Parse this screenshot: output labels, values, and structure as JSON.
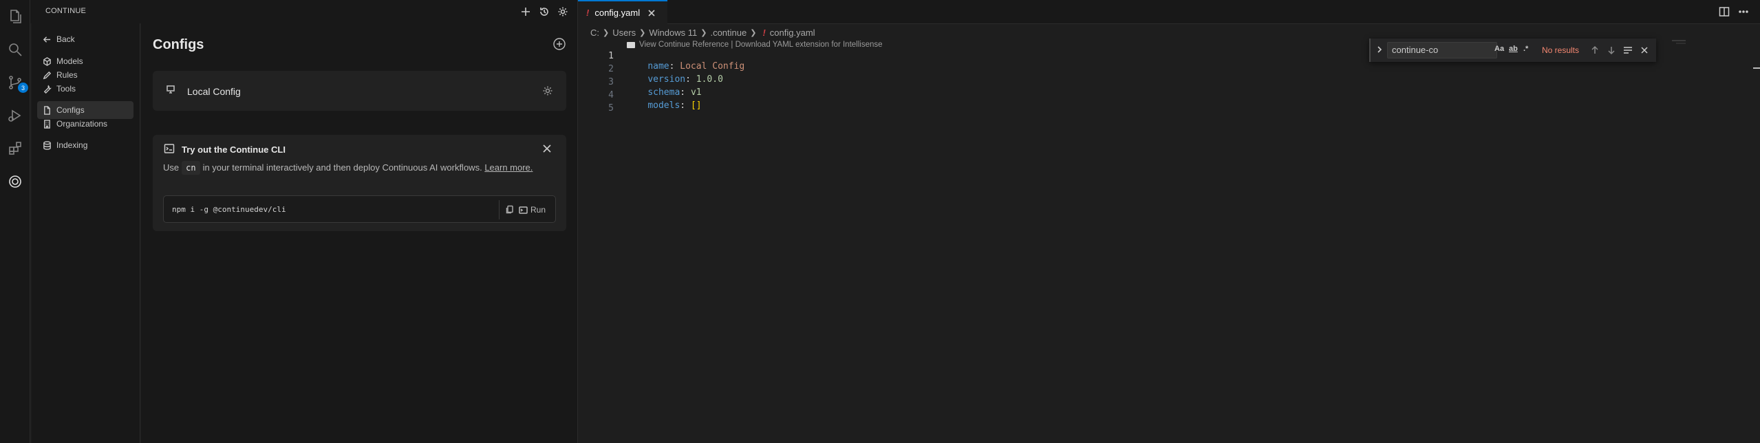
{
  "sidebar_header": {
    "title": "CONTINUE"
  },
  "nav": {
    "back": "Back",
    "items": [
      {
        "label": "Models",
        "icon": "cube-icon"
      },
      {
        "label": "Rules",
        "icon": "pencil-icon"
      },
      {
        "label": "Tools",
        "icon": "wrench-icon"
      },
      {
        "label": "Configs",
        "icon": "file-icon",
        "active": true
      },
      {
        "label": "Organizations",
        "icon": "building-icon"
      },
      {
        "label": "Indexing",
        "icon": "database-icon"
      }
    ]
  },
  "activity_badge": "3",
  "main": {
    "title": "Configs",
    "config_card": {
      "name": "Local Config"
    },
    "cli_card": {
      "title": "Try out the Continue CLI",
      "desc_prefix": "Use",
      "desc_code": "cn",
      "desc_suffix": "in your terminal interactively and then deploy Continuous AI workflows.",
      "learn_more": "Learn more.",
      "command": "npm i -g @continuedev/cli",
      "run_label": "Run"
    }
  },
  "editor": {
    "tab": {
      "name": "config.yaml",
      "lang_mark": "!"
    },
    "breadcrumb": [
      "C:",
      "Users",
      "Windows 11",
      ".continue",
      "config.yaml"
    ],
    "codelens": "View Continue Reference | Download YAML extension for Intellisense",
    "line_numbers": [
      "1",
      "2",
      "3",
      "4",
      "5"
    ],
    "lines": [
      {
        "key": "name",
        "value": "Local Config",
        "type": "string"
      },
      {
        "key": "version",
        "value": "1.0.0",
        "type": "number"
      },
      {
        "key": "schema",
        "value": "v1",
        "type": "number"
      },
      {
        "key": "models",
        "value": "[]",
        "type": "bracket"
      }
    ],
    "colon": ":"
  },
  "find": {
    "query": "continue-co",
    "match_case": "Aa",
    "whole_word": "ab",
    "regex": ".*",
    "status": "No results"
  },
  "colors": {
    "accent": "#0078d4",
    "yaml_mark": "#cc3e44",
    "no_results": "#f48771"
  }
}
